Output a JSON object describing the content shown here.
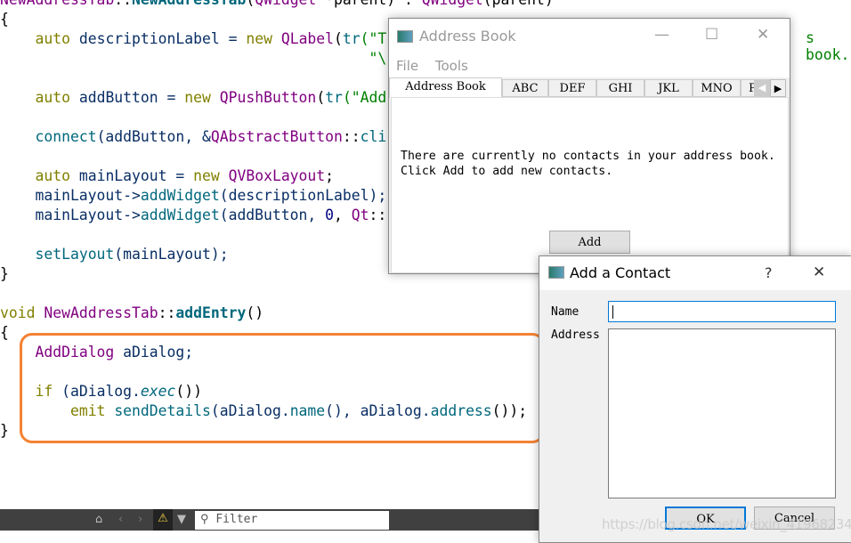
{
  "code_lines": [
    [
      [
        "NewAddressTab",
        "ty"
      ],
      [
        "::",
        "pl"
      ],
      [
        "NewAddressTab",
        "bo"
      ],
      [
        "(",
        "pl"
      ],
      [
        "QWidget",
        "ty"
      ],
      [
        " *parent) : ",
        "pl"
      ],
      [
        "QWidget",
        "ty"
      ],
      [
        "(parent)",
        "pl"
      ]
    ],
    [
      [
        "{",
        "pl"
      ]
    ],
    [
      [
        "    ",
        "pl"
      ],
      [
        "auto",
        "kw"
      ],
      [
        " descriptionLabel = ",
        "va"
      ],
      [
        "new",
        "kw"
      ],
      [
        " ",
        "pl"
      ],
      [
        "QLabel",
        "ty"
      ],
      [
        "(",
        "pl"
      ],
      [
        "tr",
        "fn"
      ],
      [
        "(\"T",
        "st"
      ]
    ],
    [
      [
        "                                          \"\\",
        "st"
      ]
    ],
    [],
    [
      [
        "    ",
        "pl"
      ],
      [
        "auto",
        "kw"
      ],
      [
        " addButton = ",
        "va"
      ],
      [
        "new",
        "kw"
      ],
      [
        " ",
        "pl"
      ],
      [
        "QPushButton",
        "ty"
      ],
      [
        "(",
        "pl"
      ],
      [
        "tr",
        "fn"
      ],
      [
        "(\"Add",
        "st"
      ]
    ],
    [],
    [
      [
        "    ",
        "pl"
      ],
      [
        "connect",
        "fn"
      ],
      [
        "(addButton, &",
        "va"
      ],
      [
        "QAbstractButton",
        "ty"
      ],
      [
        "::",
        "pl"
      ],
      [
        "cli",
        "fn"
      ]
    ],
    [],
    [
      [
        "    ",
        "pl"
      ],
      [
        "auto",
        "kw"
      ],
      [
        " mainLayout = ",
        "va"
      ],
      [
        "new",
        "kw"
      ],
      [
        " ",
        "pl"
      ],
      [
        "QVBoxLayout",
        "ty"
      ],
      [
        ";",
        "pl"
      ]
    ],
    [
      [
        "    mainLayout->",
        "va"
      ],
      [
        "addWidget",
        "fn"
      ],
      [
        "(descriptionLabel);",
        "va"
      ]
    ],
    [
      [
        "    mainLayout->",
        "va"
      ],
      [
        "addWidget",
        "fn"
      ],
      [
        "(addButton, ",
        "va"
      ],
      [
        "0",
        "nu"
      ],
      [
        ", ",
        "pl"
      ],
      [
        "Qt",
        "ty"
      ],
      [
        "::",
        "pl"
      ]
    ],
    [],
    [
      [
        "    ",
        "pl"
      ],
      [
        "setLayout",
        "fn"
      ],
      [
        "(mainLayout);",
        "va"
      ]
    ],
    [
      [
        "}",
        "pl"
      ]
    ],
    [],
    [
      [
        "void",
        "kw"
      ],
      [
        " ",
        "pl"
      ],
      [
        "NewAddressTab",
        "ty"
      ],
      [
        "::",
        "pl"
      ],
      [
        "addEntry",
        "bo"
      ],
      [
        "()",
        "pl"
      ]
    ],
    [
      [
        "{",
        "pl"
      ]
    ],
    [
      [
        "    ",
        "pl"
      ],
      [
        "AddDialog",
        "ty"
      ],
      [
        " aDialog;",
        "va"
      ]
    ],
    [],
    [
      [
        "    ",
        "pl"
      ],
      [
        "if",
        "kw"
      ],
      [
        " (aDialog.",
        "va"
      ],
      [
        "exec",
        "it"
      ],
      [
        "())",
        "pl"
      ]
    ],
    [
      [
        "        ",
        "pl"
      ],
      [
        "emit",
        "kw"
      ],
      [
        " ",
        "pl"
      ],
      [
        "sendDetails",
        "fn"
      ],
      [
        "(aDialog.",
        "va"
      ],
      [
        "name",
        "fn"
      ],
      [
        "(), aDialog.",
        "va"
      ],
      [
        "address",
        "fn"
      ],
      [
        "());",
        "pl"
      ]
    ],
    [
      [
        "}",
        "pl"
      ]
    ]
  ],
  "code_tail": "s book.",
  "statusbar": {
    "filter_placeholder": "Filter"
  },
  "address_book": {
    "title": "Address Book",
    "menu": [
      "File",
      "Tools"
    ],
    "tabs": [
      "Address Book",
      "ABC",
      "DEF",
      "GHI",
      "JKL",
      "MNO",
      "P"
    ],
    "message": "There are currently no contacts in your address book.\nClick Add to add new contacts.",
    "add_label": "Add"
  },
  "add_contact": {
    "title": "Add a Contact",
    "help": "?",
    "name_label": "Name",
    "address_label": "Address",
    "name_value": "",
    "address_value": "",
    "ok_label": "OK",
    "cancel_label": "Cancel"
  },
  "watermark": "https://blog.csdn.net/weixin_41968234",
  "colors": {
    "highlight": "#f58232",
    "focus": "#0078d7"
  }
}
